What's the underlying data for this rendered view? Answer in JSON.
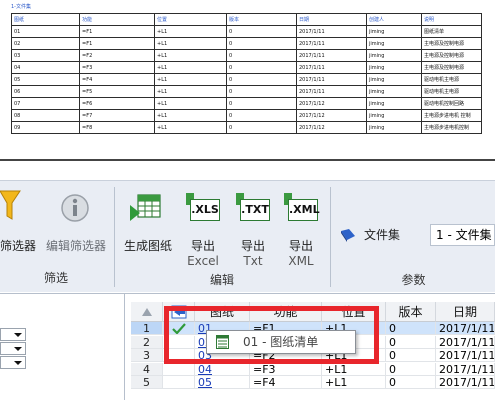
{
  "preview": {
    "sheet_title": "1-文件集",
    "headers": [
      "图纸",
      "功能",
      "位置",
      "版本",
      "日期",
      "创建人",
      "说明"
    ],
    "rows": [
      [
        "01",
        "=F1",
        "+L1",
        "0",
        "2017/1/11",
        "jiming",
        "图纸清单"
      ],
      [
        "02",
        "=F1",
        "+L1",
        "0",
        "2017/1/11",
        "jiming",
        "主电源及控制电源"
      ],
      [
        "03",
        "=F2",
        "+L1",
        "0",
        "2017/1/11",
        "jiming",
        "主电源及控制电源"
      ],
      [
        "04",
        "=F3",
        "+L1",
        "0",
        "2017/1/11",
        "jiming",
        "主电源及控制电源"
      ],
      [
        "05",
        "=F4",
        "+L1",
        "0",
        "2017/1/11",
        "jiming",
        "驱动电机主电源"
      ],
      [
        "06",
        "=F5",
        "+L1",
        "0",
        "2017/1/11",
        "jiming",
        "驱动电机主电源"
      ],
      [
        "07",
        "=F6",
        "+L1",
        "0",
        "2017/1/12",
        "jiming",
        "驱动电机控制回路"
      ],
      [
        "08",
        "=F7",
        "+L1",
        "0",
        "2017/1/12",
        "jiming",
        "主电源步进电机 控制"
      ],
      [
        "09",
        "=F8",
        "+L1",
        "0",
        "2017/1/12",
        "jiming",
        "主电源步进电机控制"
      ]
    ]
  },
  "ribbon": {
    "filter_group": {
      "caption": "筛选",
      "filter_label": "筛选器",
      "edit_filter_label": "编辑筛选器"
    },
    "edit_group": {
      "caption": "编辑",
      "generate_label": "生成图纸",
      "export_excel": [
        "导出",
        "Excel"
      ],
      "export_txt": [
        "导出",
        "Txt"
      ],
      "export_xml": [
        "导出",
        "XML"
      ],
      "xls_icon_text": ".XLS",
      "txt_icon_text": ".TXT",
      "xml_icon_text": ".XML"
    },
    "params_group": {
      "caption": "参数",
      "fileset_label": "文件集",
      "fileset_value": "1 - 文件集"
    }
  },
  "grid": {
    "columns": [
      "图纸",
      "功能",
      "位置",
      "版本",
      "日期"
    ],
    "rows": [
      {
        "num": "1",
        "checked": true,
        "drawing": "01",
        "func": "=F1",
        "loc": "+L1",
        "ver": "0",
        "date": "2017/1/11"
      },
      {
        "num": "2",
        "checked": false,
        "drawing": "02",
        "func": "=F1",
        "loc": "+L1",
        "ver": "0",
        "date": "2017/1/11"
      },
      {
        "num": "3",
        "checked": false,
        "drawing": "03",
        "func": "=F2",
        "loc": "+L1",
        "ver": "0",
        "date": "2017/1/11"
      },
      {
        "num": "4",
        "checked": false,
        "drawing": "04",
        "func": "=F3",
        "loc": "+L1",
        "ver": "0",
        "date": "2017/1/11"
      },
      {
        "num": "5",
        "checked": false,
        "drawing": "05",
        "func": "=F4",
        "loc": "+L1",
        "ver": "0",
        "date": "2017/1/11"
      }
    ]
  },
  "tooltip": {
    "text": "01 - 图纸清单"
  },
  "colors": {
    "highlight": "#e8262c",
    "selection": "#cfe3fb",
    "link": "#1a3db8",
    "check": "#2f9a3a"
  },
  "icons": {
    "filter": "funnel-icon",
    "edit_filter": "info-icon",
    "generate": "generate-drawing-icon",
    "excel": "xls-export-icon",
    "txt": "txt-export-icon",
    "xml": "xml-export-icon",
    "fileset": "fileset-icon",
    "grid_corner": "sort-arrow-icon",
    "grid_nav": "navigate-icon",
    "check": "check-icon"
  }
}
